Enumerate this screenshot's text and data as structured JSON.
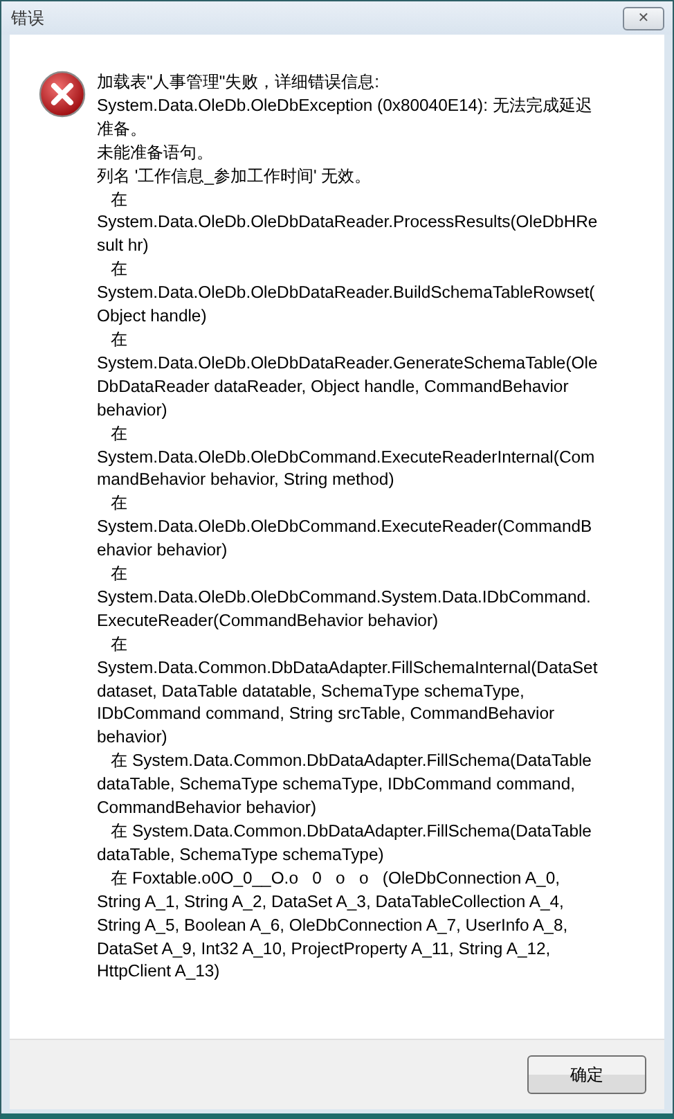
{
  "window": {
    "title": "错误",
    "close": "✕"
  },
  "message_lines": [
    "加载表\"人事管理\"失败，详细错误信息:",
    "System.Data.OleDb.OleDbException (0x80040E14): 无法完成延迟",
    "准备。",
    "未能准备语句。",
    "列名 '工作信息_参加工作时间' 无效。",
    "   在",
    "System.Data.OleDb.OleDbDataReader.ProcessResults(OleDbHRe",
    "sult hr)",
    "   在",
    "System.Data.OleDb.OleDbDataReader.BuildSchemaTableRowset(",
    "Object handle)",
    "   在",
    "System.Data.OleDb.OleDbDataReader.GenerateSchemaTable(Ole",
    "DbDataReader dataReader, Object handle, CommandBehavior",
    "behavior)",
    "   在",
    "System.Data.OleDb.OleDbCommand.ExecuteReaderInternal(Com",
    "mandBehavior behavior, String method)",
    "   在",
    "System.Data.OleDb.OleDbCommand.ExecuteReader(CommandB",
    "ehavior behavior)",
    "   在",
    "System.Data.OleDb.OleDbCommand.System.Data.IDbCommand.",
    "ExecuteReader(CommandBehavior behavior)",
    "   在",
    "System.Data.Common.DbDataAdapter.FillSchemaInternal(DataSet",
    "dataset, DataTable datatable, SchemaType schemaType,",
    "IDbCommand command, String srcTable, CommandBehavior",
    "behavior)",
    "   在 System.Data.Common.DbDataAdapter.FillSchema(DataTable",
    "dataTable, SchemaType schemaType, IDbCommand command,",
    "CommandBehavior behavior)",
    "   在 System.Data.Common.DbDataAdapter.FillSchema(DataTable",
    "dataTable, SchemaType schemaType)",
    "   在 Foxtable.o0O_0__O.o   0   o   o   (OleDbConnection A_0,",
    "String A_1, String A_2, DataSet A_3, DataTableCollection A_4,",
    "String A_5, Boolean A_6, OleDbConnection A_7, UserInfo A_8,",
    "DataSet A_9, Int32 A_10, ProjectProperty A_11, String A_12,",
    "HttpClient A_13)"
  ],
  "buttons": [
    {
      "label": "确定"
    }
  ]
}
